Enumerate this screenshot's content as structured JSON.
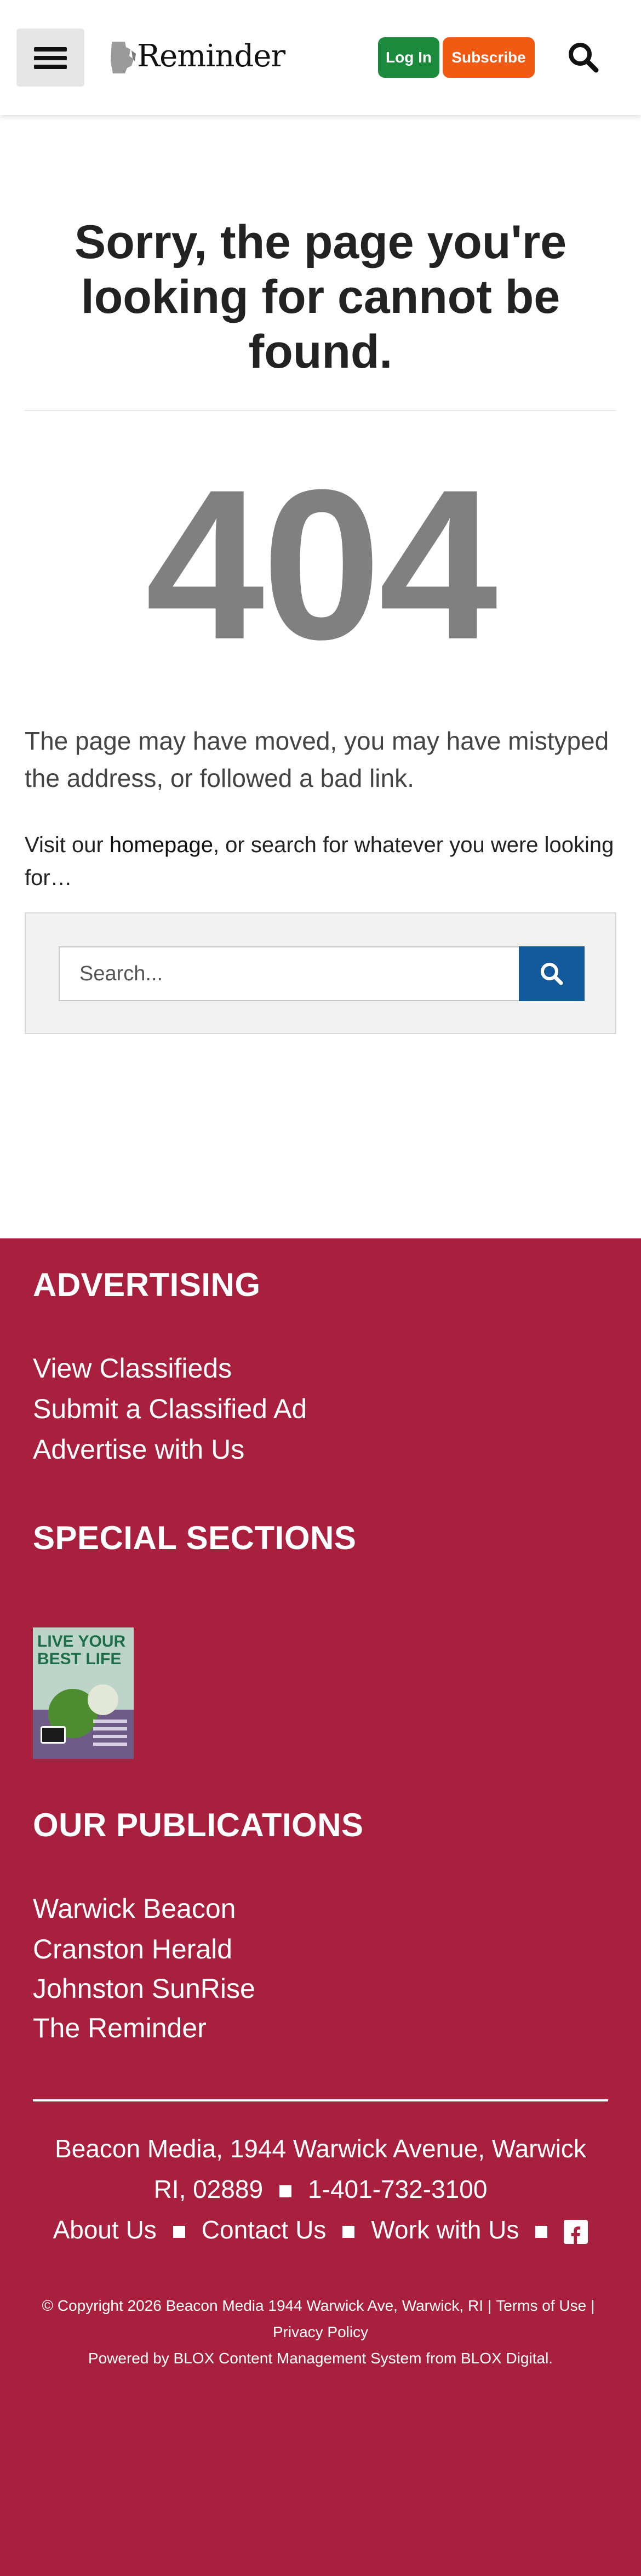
{
  "header": {
    "logo_text": "Reminder",
    "login_label": "Log In",
    "subscribe_label": "Subscribe",
    "colors": {
      "login": "#1b8a3d",
      "subscribe": "#f15a12"
    }
  },
  "main": {
    "title": "Sorry, the page you're looking for cannot be found.",
    "code": "404",
    "description": "The page may have moved, you may have mistyped the address, or followed a bad link.",
    "visit_prefix": "Visit our ",
    "homepage_link": "homepage",
    "visit_suffix": ", or search for whatever you were looking for…",
    "search_placeholder": "Search..."
  },
  "footer": {
    "color": "#a8203d",
    "advertising": {
      "heading": "ADVERTISING",
      "links": [
        "View Classifieds",
        "Submit a Classified Ad",
        "Advertise with Us"
      ]
    },
    "special": {
      "heading": "SPECIAL SECTIONS",
      "thumb_title": "LIVE YOUR BEST LIFE"
    },
    "publications": {
      "heading": "OUR PUBLICATIONS",
      "links": [
        "Warwick Beacon",
        "Cranston Herald",
        "Johnston SunRise",
        "The Reminder"
      ]
    },
    "address_line1": "Beacon Media, 1944 Warwick Avenue, Warwick",
    "address_line2_a": "RI, 02889",
    "address_line2_b": "1-401-732-3100",
    "nav": [
      "About Us",
      "Contact Us",
      "Work with Us"
    ],
    "copyright": "© Copyright 2026 Beacon Media 1944 Warwick Ave, Warwick, RI",
    "terms": "Terms of Use",
    "privacy": "Privacy Policy",
    "powered": "Powered by BLOX Content Management System from BLOX Digital."
  }
}
